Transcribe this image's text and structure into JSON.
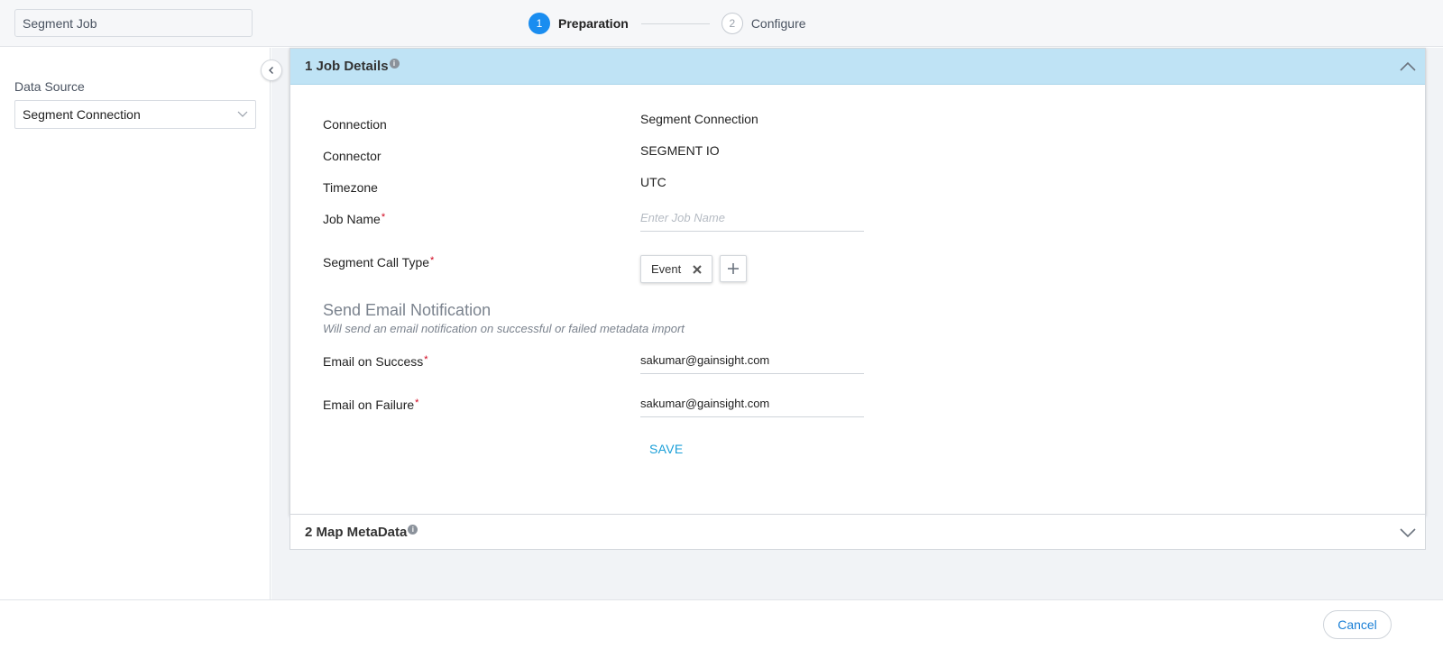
{
  "header": {
    "job_title": "Segment Job",
    "steps": [
      {
        "number": "1",
        "label": "Preparation"
      },
      {
        "number": "2",
        "label": "Configure"
      }
    ]
  },
  "sidebar": {
    "data_source_label": "Data Source",
    "data_source_value": "Segment Connection"
  },
  "job_details": {
    "title": "1 Job Details",
    "fields": {
      "connection_label": "Connection",
      "connection_value": "Segment Connection",
      "connector_label": "Connector",
      "connector_value": "SEGMENT IO",
      "timezone_label": "Timezone",
      "timezone_value": "UTC",
      "job_name_label": "Job Name",
      "job_name_placeholder": "Enter Job Name",
      "call_type_label": "Segment Call Type",
      "call_type_chip": "Event"
    },
    "notification": {
      "title": "Send Email Notification",
      "subtitle": "Will send an email notification on successful or failed metadata import",
      "success_label": "Email on Success",
      "success_value": "sakumar@gainsight.com",
      "failure_label": "Email on Failure",
      "failure_value": "sakumar@gainsight.com"
    },
    "required_mark": "*",
    "save_label": "SAVE"
  },
  "map_metadata": {
    "title": "2 Map MetaData"
  },
  "footer": {
    "cancel_label": "Cancel"
  },
  "colors": {
    "accent": "#1a8df0",
    "header_band": "#bfe3f5",
    "save_text": "#1a9fd8",
    "required": "#d0021b"
  }
}
